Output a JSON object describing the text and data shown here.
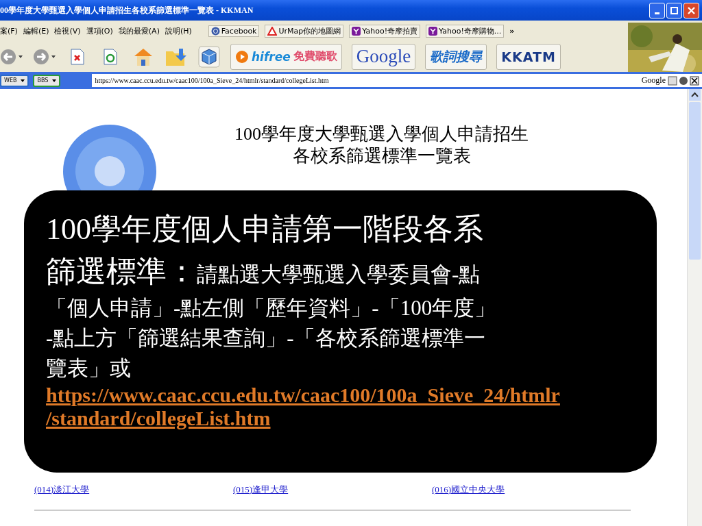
{
  "window": {
    "title": "00學年度大學甄選入學個人申請招生各校系篩選標準一覽表 - KKMAN"
  },
  "menu": [
    "案(F)",
    "編輯(E)",
    "檢視(V)",
    "選項(O)",
    "我的最愛(A)",
    "說明(H)"
  ],
  "bookmarks": [
    {
      "label": "Facebook",
      "kind": "facebook"
    },
    {
      "label": "UrMap你的地圖網",
      "kind": "urmap"
    },
    {
      "label": "Yahoo!奇摩拍賣",
      "kind": "yahoo"
    },
    {
      "label": "Yahoo!奇摩購物...",
      "kind": "yahoo"
    }
  ],
  "bookmarks_more": "»",
  "toolbar": [
    {
      "kind": "back"
    },
    {
      "kind": "forward"
    },
    {
      "kind": "stop"
    },
    {
      "kind": "refresh"
    },
    {
      "kind": "home"
    },
    {
      "kind": "folder"
    },
    {
      "kind": "cube"
    }
  ],
  "banners": [
    {
      "kind": "hifree",
      "label": "hifree",
      "label_2": "免費聽歌"
    },
    {
      "kind": "google",
      "label": "Google"
    },
    {
      "kind": "lyrics",
      "label": "歌詞搜尋"
    },
    {
      "kind": "kkatm",
      "label": "KKATM"
    }
  ],
  "address_bar": {
    "dropdowns": [
      "WEB",
      "BBS"
    ],
    "url": "https://www.caac.ccu.edu.tw/caac100/100a_Sieve_24/htmlr/standard/collegeList.htm",
    "search_label": "Google"
  },
  "page": {
    "heading": [
      "100學年度大學甄選入學個人申請招生",
      "各校系篩選標準一覽表"
    ],
    "colleges": [
      "(014)淡江大學",
      "(015)逢甲大學",
      "(016)國立中央大學"
    ]
  },
  "overlay": {
    "title_lines": [
      "100學年度個人申請第一階段各系",
      "篩選標準："
    ],
    "body_lines": [
      "請點選大學甄選入學委員會-點",
      "「個人申請」-點左側「歷年資料」-「100年度」",
      "-點上方「篩選結果查詢」-「各校系篩選標準一",
      "覽表」或"
    ],
    "links": [
      "https://www.caac.ccu.edu.tw/caac100/100a_Sieve_24/htmlr",
      "/standard/collegeList.htm"
    ]
  }
}
